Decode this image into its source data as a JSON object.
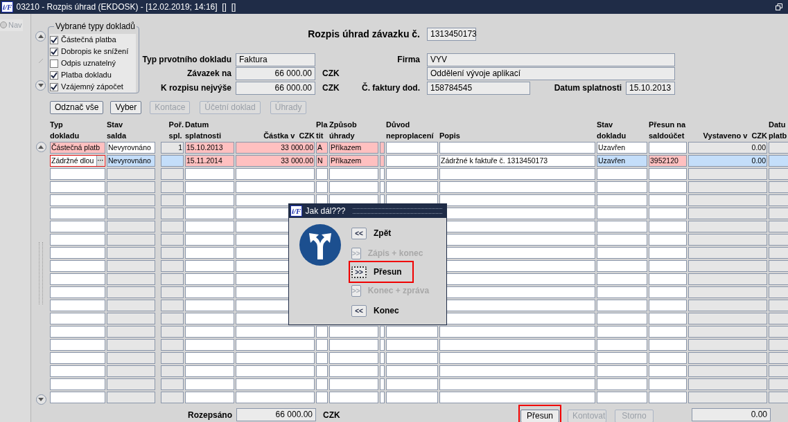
{
  "window": {
    "title": "03210 - Rozpis úhrad (EKDOSK) - [12.02.2019; 14:16]  []  []",
    "logo": "i/F"
  },
  "sidebar": {
    "nav": {
      "label": "Nav",
      "disabled": true
    }
  },
  "document_types": {
    "title": "Vybrané typy dokladů",
    "items": [
      {
        "label": "Částečná platba",
        "checked": true
      },
      {
        "label": "Dobropis ke snížení",
        "checked": true
      },
      {
        "label": "Odpis uznatelný",
        "checked": false
      },
      {
        "label": "Platba dokladu",
        "checked": true
      },
      {
        "label": "Vzájemný zápočet",
        "checked": true
      }
    ]
  },
  "header": {
    "title": "Rozpis úhrad závazku č.",
    "number": "1313450173",
    "typ_label": "Typ prvotního dokladu",
    "typ": "Faktura",
    "firma_label": "Firma",
    "firma": "VYV",
    "firma_name": "Oddělení vývoje aplikací",
    "zavazek_label": "Závazek na",
    "zavazek": "66 000.00",
    "zavazek_currency": "CZK",
    "rozpis_label": "K rozpisu nejvýše",
    "rozpis": "66 000.00",
    "rozpis_currency": "CZK",
    "faktura_label": "Č. faktury dod.",
    "faktura": "158784545",
    "splatnost_label": "Datum splatnosti",
    "splatnost": "15.10.2013"
  },
  "buttons": [
    {
      "label": "Odznač vše",
      "disabled": false
    },
    {
      "label": "Vyber",
      "disabled": false
    },
    {
      "label": "Kontace",
      "disabled": true
    },
    {
      "label": "Účetní doklad",
      "disabled": true
    },
    {
      "label": "Úhrady",
      "disabled": true
    }
  ],
  "table": {
    "columns": [
      {
        "lines": [
          "Typ",
          "dokladu"
        ],
        "kind": "editable"
      },
      {
        "lines": [
          "Stav",
          "salda"
        ],
        "kind": "readonly"
      },
      {
        "lines": [
          "Poř.",
          "spl."
        ],
        "kind": "readonly"
      },
      {
        "lines": [
          "Datum",
          "splatnosti"
        ],
        "kind": "editable"
      },
      {
        "lines": [
          "Částka v"
        ],
        "unit": "CZK",
        "kind": "editable"
      },
      {
        "lines": [
          "Pla",
          "tit"
        ],
        "kind": "editable"
      },
      {
        "lines": [
          "Způsob",
          "úhrady"
        ],
        "kind": "editable"
      },
      {
        "kind": "editable"
      },
      {
        "lines": [
          "Důvod",
          "neproplacení"
        ],
        "kind": "editable"
      },
      {
        "lines": [
          "Popis"
        ],
        "kind": "editable"
      },
      {
        "lines": [
          "Stav",
          "dokladu"
        ],
        "kind": "editable"
      },
      {
        "lines": [
          "Přesun na",
          "saldoúčet"
        ],
        "kind": "editable"
      },
      {
        "lines": [
          "Vystaveno v"
        ],
        "unit": "CZK",
        "kind": "readonly"
      },
      {
        "lines": [
          "Datu",
          "platb"
        ],
        "kind": "readonly"
      }
    ],
    "rows": [
      {
        "cells": [
          {
            "text": "Částečná platb",
            "kind": "required"
          },
          {
            "text": "Nevyrovnáno",
            "kind": "editable"
          },
          {
            "text": "1",
            "kind": "readonly"
          },
          {
            "text": "15.10.2013",
            "kind": "required"
          },
          {
            "text": "33 000.00",
            "kind": "required"
          },
          {
            "text": "A",
            "kind": "required"
          },
          {
            "text": "Příkazem",
            "kind": "required"
          },
          {
            "kind": "required"
          },
          {
            "kind": "editable"
          },
          {
            "kind": "editable"
          },
          {
            "text": "Uzavřen",
            "kind": "editable"
          },
          {
            "kind": "editable"
          },
          {
            "text": "0.00",
            "kind": "readonly"
          },
          {
            "kind": "readonly"
          }
        ]
      },
      {
        "cells": [
          {
            "text": "Zádržné dlou",
            "kind": "editable",
            "focused": true,
            "button": "···"
          },
          {
            "text": "Nevyrovnáno",
            "kind": "current"
          },
          {
            "kind": "current"
          },
          {
            "text": "15.11.2014",
            "kind": "required"
          },
          {
            "text": "33 000.00",
            "kind": "required"
          },
          {
            "text": "N",
            "kind": "required"
          },
          {
            "text": "Příkazem",
            "kind": "required"
          },
          {
            "kind": "required"
          },
          {
            "kind": "editable"
          },
          {
            "text": "Zádržné k faktuře č. 1313450173",
            "kind": "editable"
          },
          {
            "text": "Uzavřen",
            "kind": "current"
          },
          {
            "text": "3952120",
            "kind": "required"
          },
          {
            "text": "0.00",
            "kind": "current"
          },
          {
            "kind": "current"
          }
        ]
      }
    ]
  },
  "footer": {
    "label": "Rozepsáno",
    "total": "66 000.00",
    "currency": "CZK",
    "buttons": [
      {
        "label": "Přesun",
        "disabled": false,
        "highlighted": true
      },
      {
        "label": "Kontovat",
        "disabled": true,
        "highlighted": false
      },
      {
        "label": "Storno",
        "disabled": true,
        "highlighted": false
      }
    ],
    "amount": "0.00"
  },
  "dialog": {
    "title": "Jak dál???",
    "logo": "i/F",
    "options": [
      {
        "glyph": "<<",
        "label": "Zpět",
        "disabled": false,
        "focused": false,
        "highlighted": false
      },
      {
        "glyph": ">>",
        "label": "Zápis + konec",
        "disabled": true,
        "focused": false,
        "highlighted": false
      },
      {
        "glyph": ">>",
        "label": "Přesun",
        "disabled": false,
        "focused": true,
        "highlighted": true
      },
      {
        "glyph": ">>",
        "label": "Konec + zpráva",
        "disabled": true,
        "focused": false,
        "highlighted": false
      },
      {
        "glyph": "<<",
        "label": "Konec",
        "disabled": false,
        "focused": false,
        "highlighted": false
      }
    ]
  }
}
